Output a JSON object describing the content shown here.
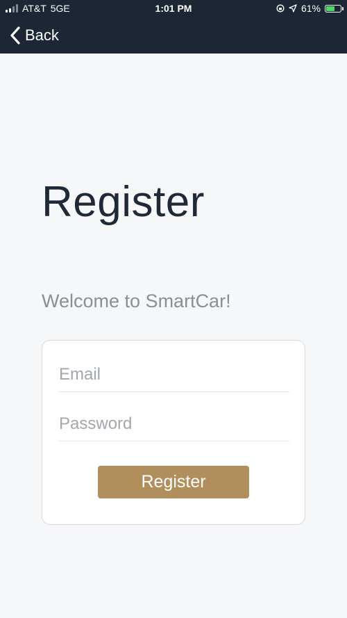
{
  "status_bar": {
    "carrier": "AT&T",
    "network": "5GE",
    "time": "1:01 PM",
    "battery_percent": "61%",
    "battery_level": 0.61,
    "battery_color": "#4cd964"
  },
  "nav": {
    "back_label": "Back",
    "back_icon": "chevron-left-icon",
    "background": "#1c2634"
  },
  "page": {
    "title": "Register",
    "welcome": "Welcome to SmartCar!"
  },
  "form": {
    "email_placeholder": "Email",
    "email_value": "",
    "password_placeholder": "Password",
    "password_value": "",
    "submit_label": "Register",
    "accent": "#b08f5c"
  }
}
